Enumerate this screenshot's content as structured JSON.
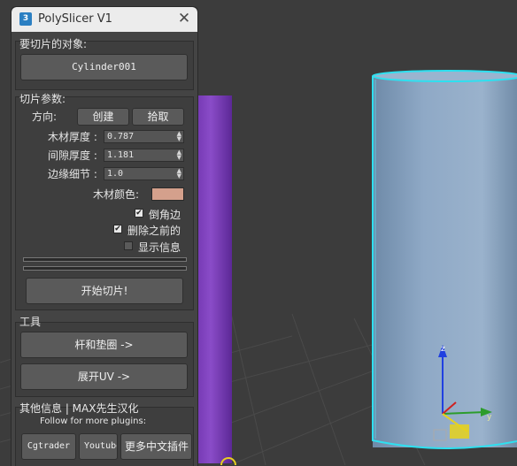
{
  "window": {
    "title": "PolySlicer V1",
    "icon_text": "3",
    "close_glyph": "✕"
  },
  "object_section": {
    "label": "要切片的对象:",
    "object_button": "Cylinder001"
  },
  "params_section": {
    "label": "切片参数:",
    "direction_label": "方向:",
    "create_button": "创建",
    "pick_button": "拾取",
    "wood_thickness": {
      "label": "木材厚度 :",
      "value": "0.787"
    },
    "gap_thickness": {
      "label": "间隙厚度 :",
      "value": "1.181"
    },
    "edge_detail": {
      "label": "边缘细节 :",
      "value": "1.0"
    },
    "wood_color": {
      "label": "木材颜色:",
      "color": "#d4a08c"
    },
    "checkboxes": [
      {
        "label": "倒角边",
        "checked": "✔"
      },
      {
        "label": "删除之前的",
        "checked": "✔"
      },
      {
        "label": "显示信息",
        "checked": ""
      }
    ],
    "start_button": "开始切片!"
  },
  "tools_section": {
    "label": "工具",
    "rod_button": "杆和垫圈    ->",
    "uv_button": "展开UV     ->"
  },
  "info_section": {
    "label": "其他信息 | MAX先生汉化",
    "follow_text": "Follow for more plugins:",
    "links": [
      "Cgtrader",
      "Youtube",
      "更多中文插件"
    ]
  },
  "viewport": {
    "background": "#3c3c3c",
    "purple_object_color": "#7a3fb8",
    "cylinder_color": "#8aa6c4",
    "selection_color": "#2ee0f0",
    "axes": {
      "z": "z",
      "y": "y"
    }
  }
}
